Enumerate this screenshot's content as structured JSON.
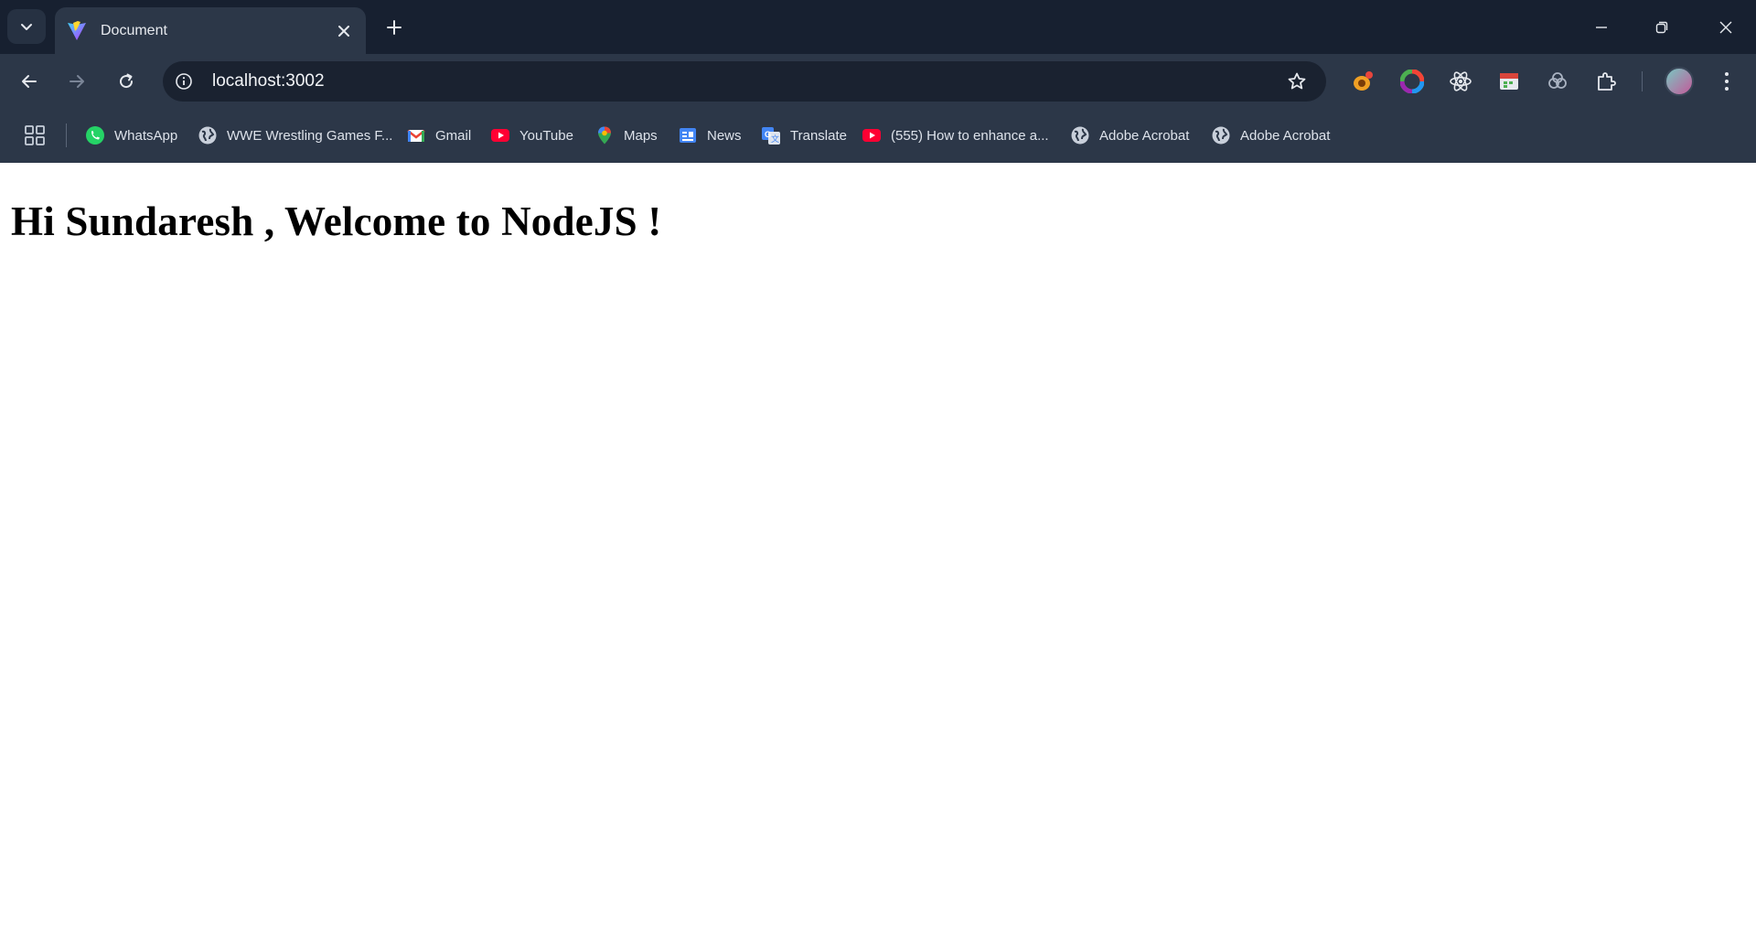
{
  "window": {
    "tab": {
      "title": "Document",
      "favicon": "vite-icon"
    },
    "controls": [
      "minimize-icon",
      "restore-icon",
      "close-icon"
    ]
  },
  "toolbar": {
    "url": "localhost:3002",
    "extensions": [
      "extension-bug-icon",
      "color-picker-extension-icon",
      "react-devtools-icon",
      "extension-calendar-icon",
      "extension-cluster-icon",
      "extensions-puzzle-icon"
    ]
  },
  "bookmarks": [
    {
      "label": "WhatsApp",
      "icon": "whatsapp-icon"
    },
    {
      "label": "WWE Wrestling Games F...",
      "icon": "globe-icon"
    },
    {
      "label": "Gmail",
      "icon": "gmail-icon"
    },
    {
      "label": "YouTube",
      "icon": "youtube-icon"
    },
    {
      "label": "Maps",
      "icon": "maps-icon"
    },
    {
      "label": "News",
      "icon": "news-icon"
    },
    {
      "label": "Translate",
      "icon": "translate-icon"
    },
    {
      "label": "(555) How to enhance a...",
      "icon": "youtube-icon"
    },
    {
      "label": "Adobe Acrobat",
      "icon": "globe-icon"
    },
    {
      "label": "Adobe Acrobat",
      "icon": "globe-icon"
    }
  ],
  "page": {
    "heading": "Hi Sundaresh , Welcome to NodeJS !"
  }
}
